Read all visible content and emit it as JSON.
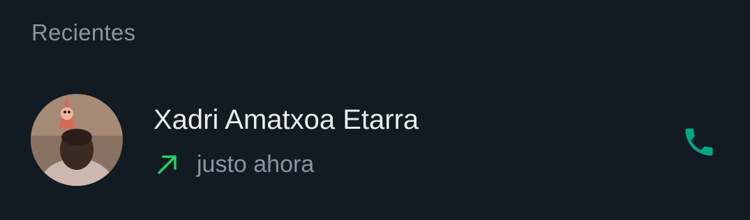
{
  "section": {
    "title": "Recientes"
  },
  "calls": [
    {
      "name": "Xadri Amatxoa Etarra",
      "time": "justo ahora",
      "direction_icon": "outgoing-arrow-icon",
      "action_icon": "phone-icon"
    }
  ],
  "colors": {
    "background": "#111b21",
    "primary_text": "#e9edef",
    "secondary_text": "#8696a0",
    "outgoing_arrow": "#25d366",
    "call_icon": "#00a884"
  }
}
